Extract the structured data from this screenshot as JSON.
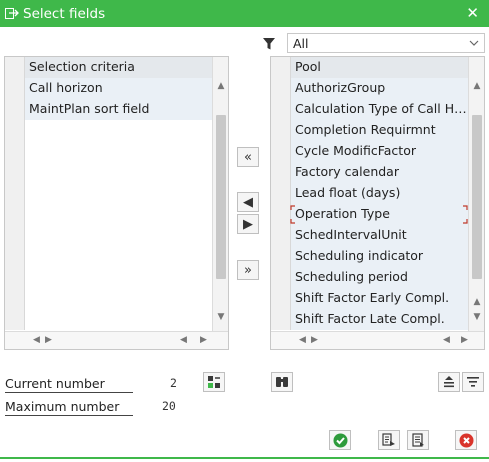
{
  "window": {
    "title": "Select fields",
    "close_glyph": "✕"
  },
  "filter": {
    "selected": "All",
    "icon": "filter-icon"
  },
  "left_table": {
    "header": "Selection criteria",
    "rows": [
      "Call horizon",
      "MaintPlan sort field"
    ]
  },
  "right_table": {
    "header": "Pool",
    "rows": [
      "AuthorizGroup",
      "Calculation Type of Call Ho...",
      "Completion Requirmnt",
      "Cycle ModificFactor",
      "Factory calendar",
      "Lead float (days)",
      "Operation Type",
      "SchedIntervalUnit",
      "Scheduling indicator",
      "Scheduling period",
      "Shift Factor Early Compl.",
      "Shift Factor Late Compl."
    ]
  },
  "middle_buttons": {
    "move_all_left": "«",
    "move_left": "◀",
    "move_right": "▶",
    "move_all_right": "»"
  },
  "counts": {
    "current_label": "Current number",
    "current_value": "2",
    "maximum_label": "Maximum number",
    "maximum_value": "20"
  },
  "colors": {
    "accent": "#3fb84a",
    "confirm": "#2e9b3c",
    "cancel": "#d9342b"
  }
}
